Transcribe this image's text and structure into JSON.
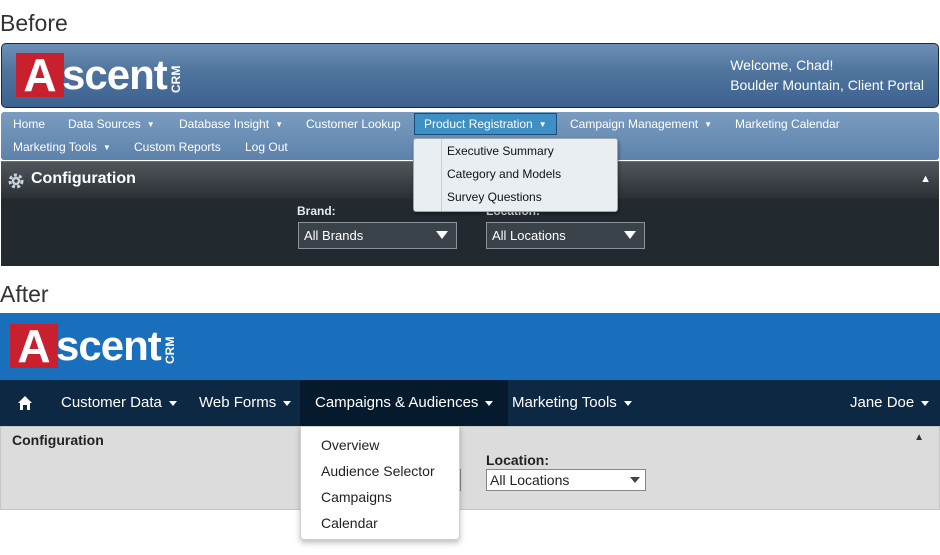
{
  "labels": {
    "before": "Before",
    "after": "After"
  },
  "before": {
    "logo": {
      "first_letter": "A",
      "rest": "scent",
      "suffix": "CRM"
    },
    "welcome": {
      "line1": "Welcome, Chad!",
      "line2": "Boulder Mountain, Client Portal"
    },
    "nav": {
      "home": "Home",
      "data_sources": "Data Sources",
      "database_insight": "Database Insight",
      "customer_lookup": "Customer Lookup",
      "product_registration": "Product Registration",
      "campaign_management": "Campaign Management",
      "marketing_calendar": "Marketing Calendar",
      "marketing_tools": "Marketing Tools",
      "custom_reports": "Custom Reports",
      "log_out": "Log Out"
    },
    "dropdown": [
      "Executive Summary",
      "Category and Models",
      "Survey Questions"
    ],
    "config": {
      "title": "Configuration",
      "brand_label": "Brand:",
      "brand_value": "All Brands",
      "location_label": "Location:",
      "location_value": "All Locations"
    }
  },
  "after": {
    "logo": {
      "first_letter": "A",
      "rest": "scent",
      "suffix": "CRM"
    },
    "nav": {
      "customer_data": "Customer Data",
      "web_forms": "Web Forms",
      "campaigns_audiences": "Campaigns & Audiences",
      "marketing_tools": "Marketing Tools",
      "user": "Jane Doe"
    },
    "dropdown": [
      "Overview",
      "Audience Selector",
      "Campaigns",
      "Calendar"
    ],
    "config": {
      "title": "Configuration",
      "location_label": "Location:",
      "location_value": "All Locations"
    }
  },
  "colors": {
    "before_header": "#4e739c",
    "before_nav": "#5d82ab",
    "after_header": "#1a6fbc",
    "after_nav": "#0d2842",
    "logo_red": "#c8202e"
  },
  "icons": [
    "gear-icon",
    "home-icon",
    "collapse-arrow-icon",
    "chevron-down-icon"
  ]
}
